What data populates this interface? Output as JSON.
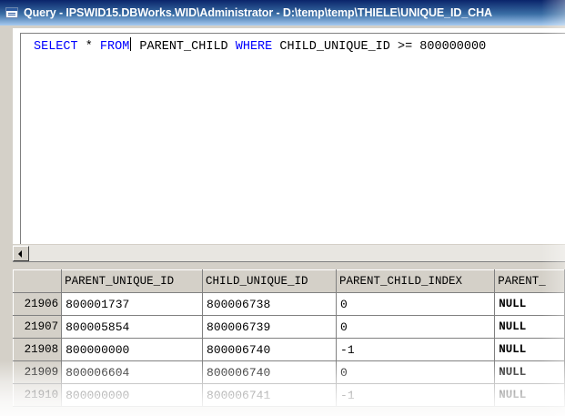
{
  "window": {
    "title": "Query - IPSWID15.DBWorks.WID\\Administrator - D:\\temp\\temp\\THIELE\\UNIQUE_ID_CHA"
  },
  "editor": {
    "sql_keyword_select": "SELECT",
    "sql_star": " * ",
    "sql_keyword_from": "FROM",
    "sql_table": " PARENT_CHILD ",
    "sql_keyword_where": "WHERE",
    "sql_condition": " CHILD_UNIQUE_ID >= 800000000"
  },
  "grid": {
    "columns": [
      "PARENT_UNIQUE_ID",
      "CHILD_UNIQUE_ID",
      "PARENT_CHILD_INDEX",
      "PARENT_"
    ],
    "rows": [
      {
        "rownum": "21906",
        "cells": [
          "800001737",
          "800006738",
          "0",
          "NULL"
        ]
      },
      {
        "rownum": "21907",
        "cells": [
          "800005854",
          "800006739",
          "0",
          "NULL"
        ]
      },
      {
        "rownum": "21908",
        "cells": [
          "800000000",
          "800006740",
          "-1",
          "NULL"
        ]
      },
      {
        "rownum": "21909",
        "cells": [
          "800006604",
          "800006740",
          "0",
          "NULL"
        ]
      },
      {
        "rownum": "21910",
        "cells": [
          "800000000",
          "800006741",
          "-1",
          "NULL"
        ]
      }
    ]
  },
  "colors": {
    "keyword": "#0000ff",
    "titlebar_start": "#0a246a",
    "chrome": "#d4d0c8"
  },
  "icons": {
    "title_icon": "query-window-icon",
    "scroll_left": "arrow-left-icon"
  }
}
